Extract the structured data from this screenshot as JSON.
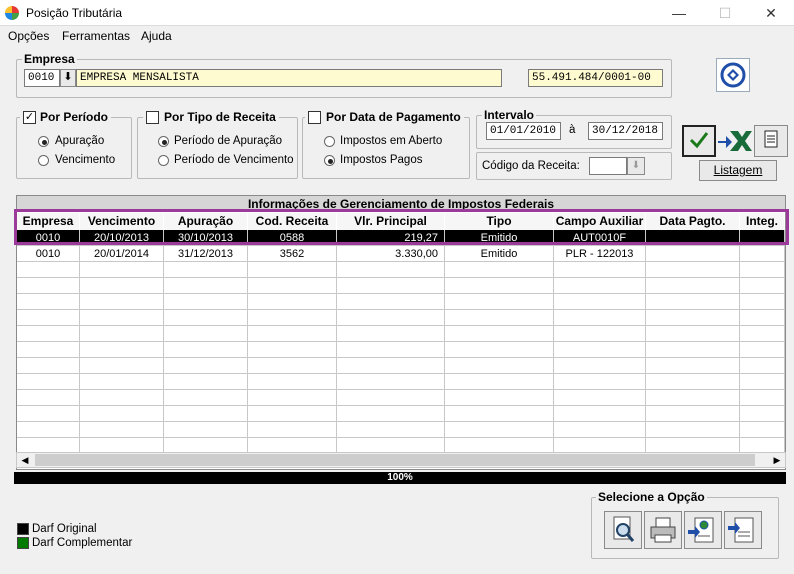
{
  "window": {
    "title": "Posição Tributária",
    "minimize": "—",
    "maximize": "☐",
    "close": "✕"
  },
  "menu": {
    "items": [
      {
        "label": "Opções"
      },
      {
        "label": "Ferramentas"
      },
      {
        "label": "Ajuda"
      }
    ]
  },
  "empresa": {
    "group_label": "Empresa",
    "code": "0010",
    "name": "EMPRESA MENSALISTA",
    "cnpj": "55.491.484/0001-00"
  },
  "filters": {
    "por_periodo": {
      "label": "Por Período",
      "checked": true,
      "options": [
        {
          "label": "Apuração",
          "selected": true
        },
        {
          "label": "Vencimento",
          "selected": false
        }
      ]
    },
    "por_tipo": {
      "label": "Por Tipo de Receita",
      "checked": false,
      "options": [
        {
          "label": "Período de Apuração",
          "selected": true
        },
        {
          "label": "Período de Vencimento",
          "selected": false
        }
      ]
    },
    "por_data": {
      "label": "Por Data de Pagamento",
      "checked": false,
      "options": [
        {
          "label": "Impostos em Aberto",
          "selected": false
        },
        {
          "label": "Impostos Pagos",
          "selected": true
        }
      ]
    }
  },
  "intervalo": {
    "label": "Intervalo",
    "start": "01/01/2010",
    "sep": "à",
    "end": "30/12/2018",
    "codigo_label": "Código da Receita:",
    "codigo_value": ""
  },
  "actions": {
    "listagem": "Listagem"
  },
  "grid": {
    "caption": "Informações de Gerenciamento de Impostos Federais",
    "columns": [
      "Empresa",
      "Vencimento",
      "Apuração",
      "Cod. Receita",
      "Vlr. Principal",
      "Tipo",
      "Campo Auxiliar",
      "Data Pagto.",
      "Integ."
    ],
    "rows": [
      [
        "0010",
        "20/10/2013",
        "30/10/2013",
        "0588",
        "219,27",
        "Emitido",
        "AUT0010F",
        "",
        ""
      ],
      [
        "0010",
        "20/01/2014",
        "31/12/2013",
        "3562",
        "3.330,00",
        "Emitido",
        "PLR - 122013",
        "",
        ""
      ]
    ]
  },
  "progress": {
    "text": "100%",
    "value": 1.0
  },
  "legend": [
    {
      "label": "Darf Original",
      "color": "#000000"
    },
    {
      "label": "Darf Complementar",
      "color": "#007a00"
    }
  ],
  "option_panel": {
    "label": "Selecione a Opção"
  },
  "colors": {
    "highlight_border": "#9b3a9b",
    "selected_row": "#000000"
  }
}
